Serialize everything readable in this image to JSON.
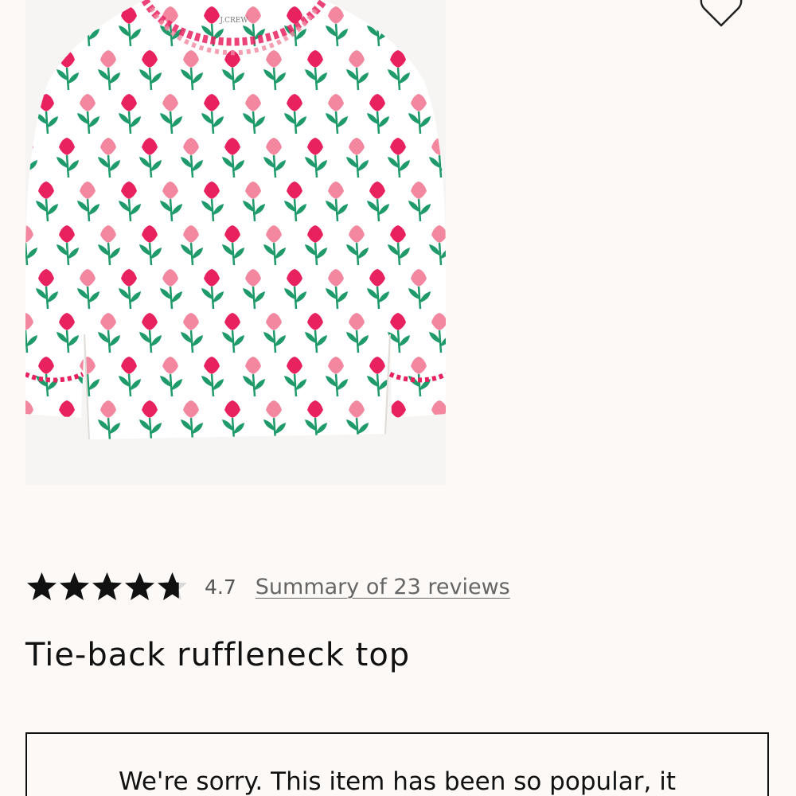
{
  "product": {
    "image_alt": "Pink floral print long-sleeve top",
    "title": "Tie-back ruffleneck top",
    "brand_label": "J.CREW"
  },
  "wishlist": {
    "icon": "heart-outline-icon"
  },
  "rating": {
    "value": "4.7",
    "stars_filled": 4.7,
    "stars_total": 5,
    "reviews_link": "Summary of 23 reviews"
  },
  "notice": {
    "text": "We're sorry. This item has been so popular, it"
  },
  "colors": {
    "background": "#fcf9f6",
    "flower_red": "#e8215f",
    "flower_pink": "#f2879f",
    "stem_green": "#1f9a6a"
  }
}
